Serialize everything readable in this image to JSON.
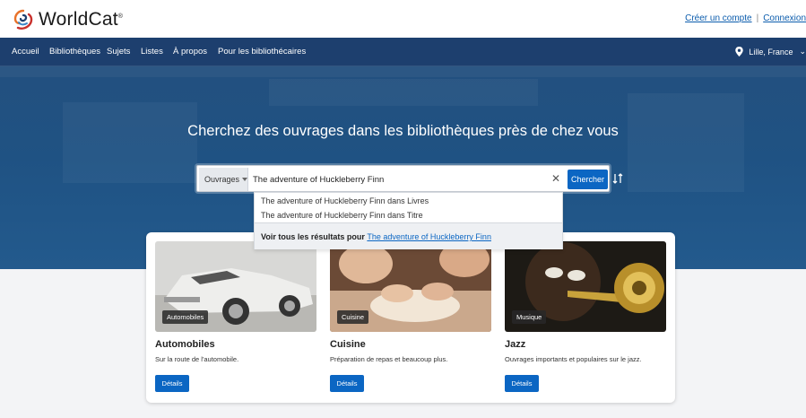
{
  "header": {
    "logo_text": "WorldCat",
    "logo_mark": "®",
    "create_account": "Créer un compte",
    "separator": "|",
    "login": "Connexion"
  },
  "nav": {
    "items": [
      "Accueil",
      "Bibliothèques",
      "Sujets",
      "Listes",
      "À propos",
      "Pour les bibliothécaires"
    ],
    "location": "Lille, France"
  },
  "hero": {
    "title": "Cherchez des ouvrages dans les bibliothèques près de chez vous"
  },
  "search": {
    "type": "Ouvrages",
    "query": "The adventure of Huckleberry Finn",
    "clear_symbol": "✕",
    "button_label": "Chercher",
    "advanced_icon": "sort-filter-icon"
  },
  "suggestions": {
    "items": [
      "The adventure of Huckleberry Finn dans Livres",
      "The adventure of Huckleberry Finn dans Titre"
    ],
    "see_all_prefix": "Voir tous les résultats pour",
    "see_all_link": "The adventure of Huckleberry Finn"
  },
  "cards": [
    {
      "badge": "Automobiles",
      "title": "Automobiles",
      "desc": "Sur la route de l'automobile.",
      "button": "Détails"
    },
    {
      "badge": "Cuisine",
      "title": "Cuisine",
      "desc": "Préparation de repas et beaucoup plus.",
      "button": "Détails"
    },
    {
      "badge": "Musique",
      "title": "Jazz",
      "desc": "Ouvrages importants et populaires sur le jazz.",
      "button": "Détails"
    }
  ],
  "colors": {
    "nav_bg": "#1d3f6e",
    "hero_bg": "#1f5283",
    "accent": "#0b66c3",
    "link": "#0b5cad"
  }
}
